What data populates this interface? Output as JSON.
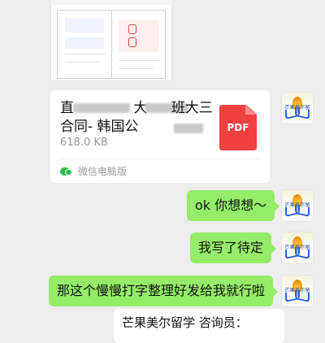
{
  "file_message": {
    "title_line1_visible": [
      "直",
      "大",
      "班大三"
    ],
    "title_line2_visible": [
      "合同-",
      "韩国公"
    ],
    "size": "618.0 KB",
    "file_type_label": "PDF",
    "source_label": "微信电脑版"
  },
  "messages": [
    {
      "id": "m1",
      "side": "right",
      "text": "ok 你想想～"
    },
    {
      "id": "m2",
      "side": "right",
      "text": "我写了待定"
    },
    {
      "id": "m3",
      "side": "right",
      "text": "那这个慢慢打字整理好发给我就行啦"
    }
  ],
  "partial_message": {
    "text": "芒果美尔留学 咨询员："
  },
  "avatar": {
    "label": "芒果美尔留学"
  },
  "colors": {
    "chat_bg": "#ededed",
    "green_bubble": "#95ec69",
    "white_bubble": "#ffffff",
    "pdf_red": "#f04040"
  },
  "icons": {
    "pdf": "pdf-file-icon",
    "wechat_pc": "wechat-pc-icon"
  }
}
